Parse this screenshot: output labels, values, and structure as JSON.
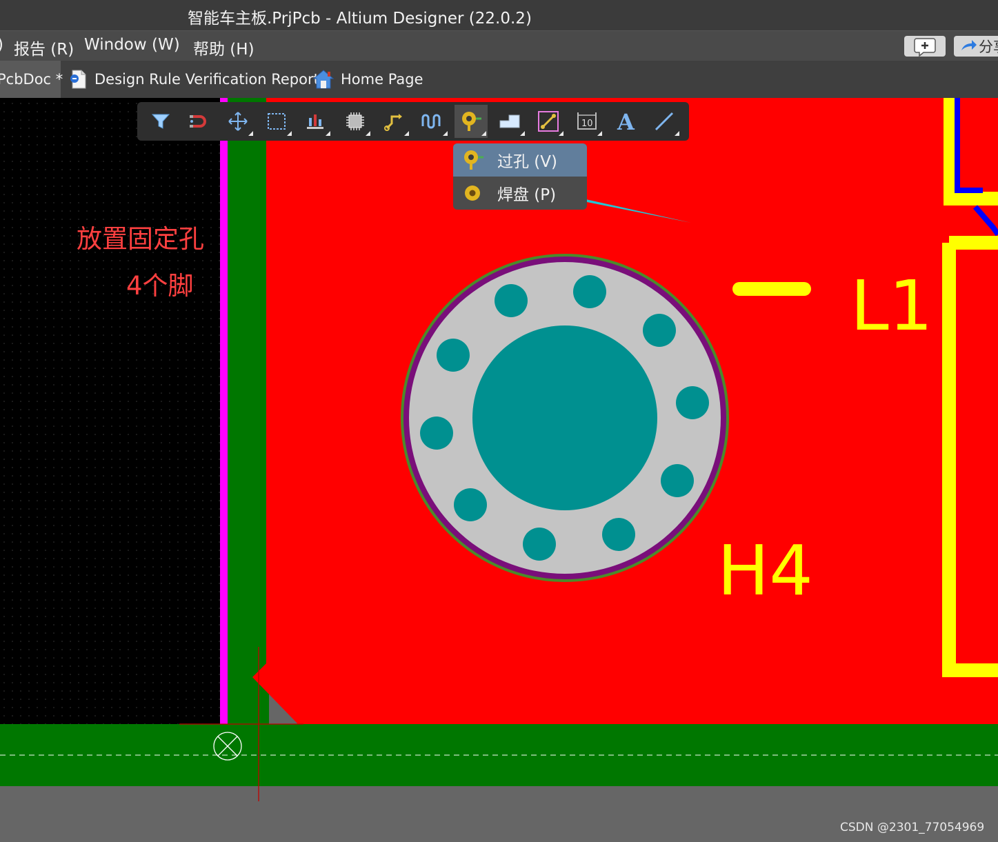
{
  "window": {
    "title": "智能车主板.PrjPcb - Altium Designer (22.0.2)"
  },
  "menu": {
    "items": [
      {
        "label": ")"
      },
      {
        "label": "报告 (R)"
      },
      {
        "label": "Window (W)"
      },
      {
        "label": "帮助 (H)"
      }
    ],
    "share_label": "分享"
  },
  "tabs": [
    {
      "label": "PcbDoc *"
    },
    {
      "label": "Design Rule Verification Report"
    },
    {
      "label": "Home Page"
    }
  ],
  "toolbar": {
    "tools": [
      "filter-icon",
      "snap-icon",
      "move-icon",
      "select-icon",
      "align-icon",
      "component-icon",
      "route-icon",
      "tune-icon",
      "via-icon",
      "fill-icon",
      "region-icon",
      "dimension-icon",
      "text-icon",
      "line-icon"
    ],
    "active": "via-icon"
  },
  "dropdown": {
    "items": [
      {
        "label": "过孔 (V)",
        "icon": "via-icon"
      },
      {
        "label": "焊盘 (P)",
        "icon": "pad-icon"
      }
    ],
    "selected_index": 0
  },
  "annotation": {
    "line1": "放置固定孔",
    "line2": "4个脚",
    "arrow_color": "#21c6d6"
  },
  "pcb": {
    "designators": [
      "L1",
      "H4"
    ],
    "colors": {
      "top_layer": "#ff0000",
      "bottom_layer": "#007700",
      "overlay": "#ffff00",
      "pad": "#009090",
      "keepout": "#ff00ff"
    }
  },
  "watermark": "CSDN @2301_77054969"
}
